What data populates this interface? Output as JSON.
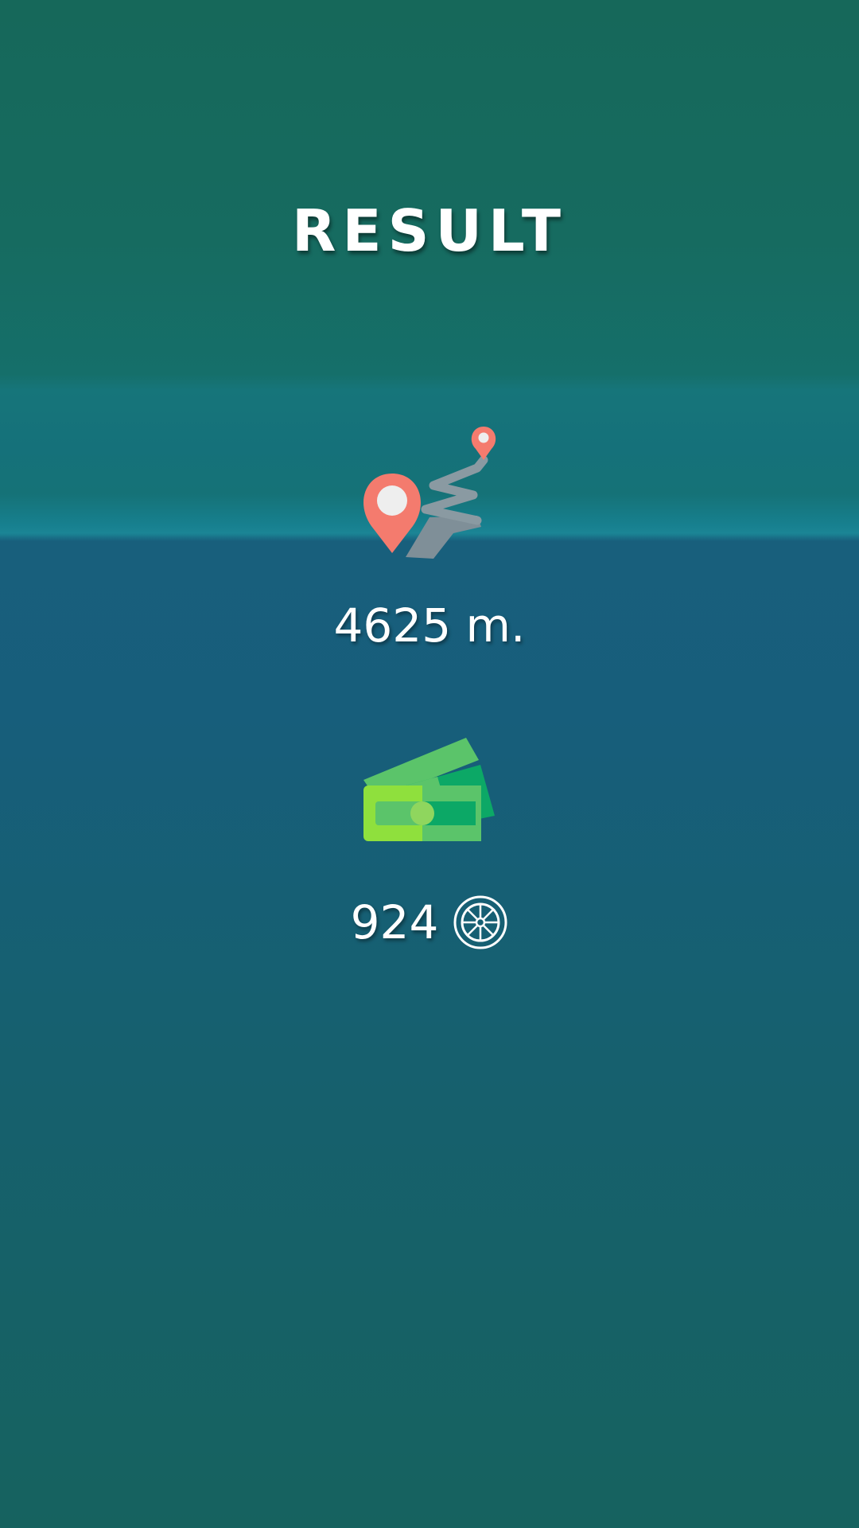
{
  "screen": {
    "title": "RESULT"
  },
  "distance": {
    "icon": "route-map-pin-icon",
    "value": "4625 m."
  },
  "coins": {
    "icon": "money-bills-icon",
    "value": "924",
    "currency_icon": "wheel-icon"
  },
  "colors": {
    "pin": "#f47b6e",
    "road": "#8a9aa2",
    "money_light": "#8fe03d",
    "money_dark": "#0ca866",
    "text": "#ffffff"
  }
}
